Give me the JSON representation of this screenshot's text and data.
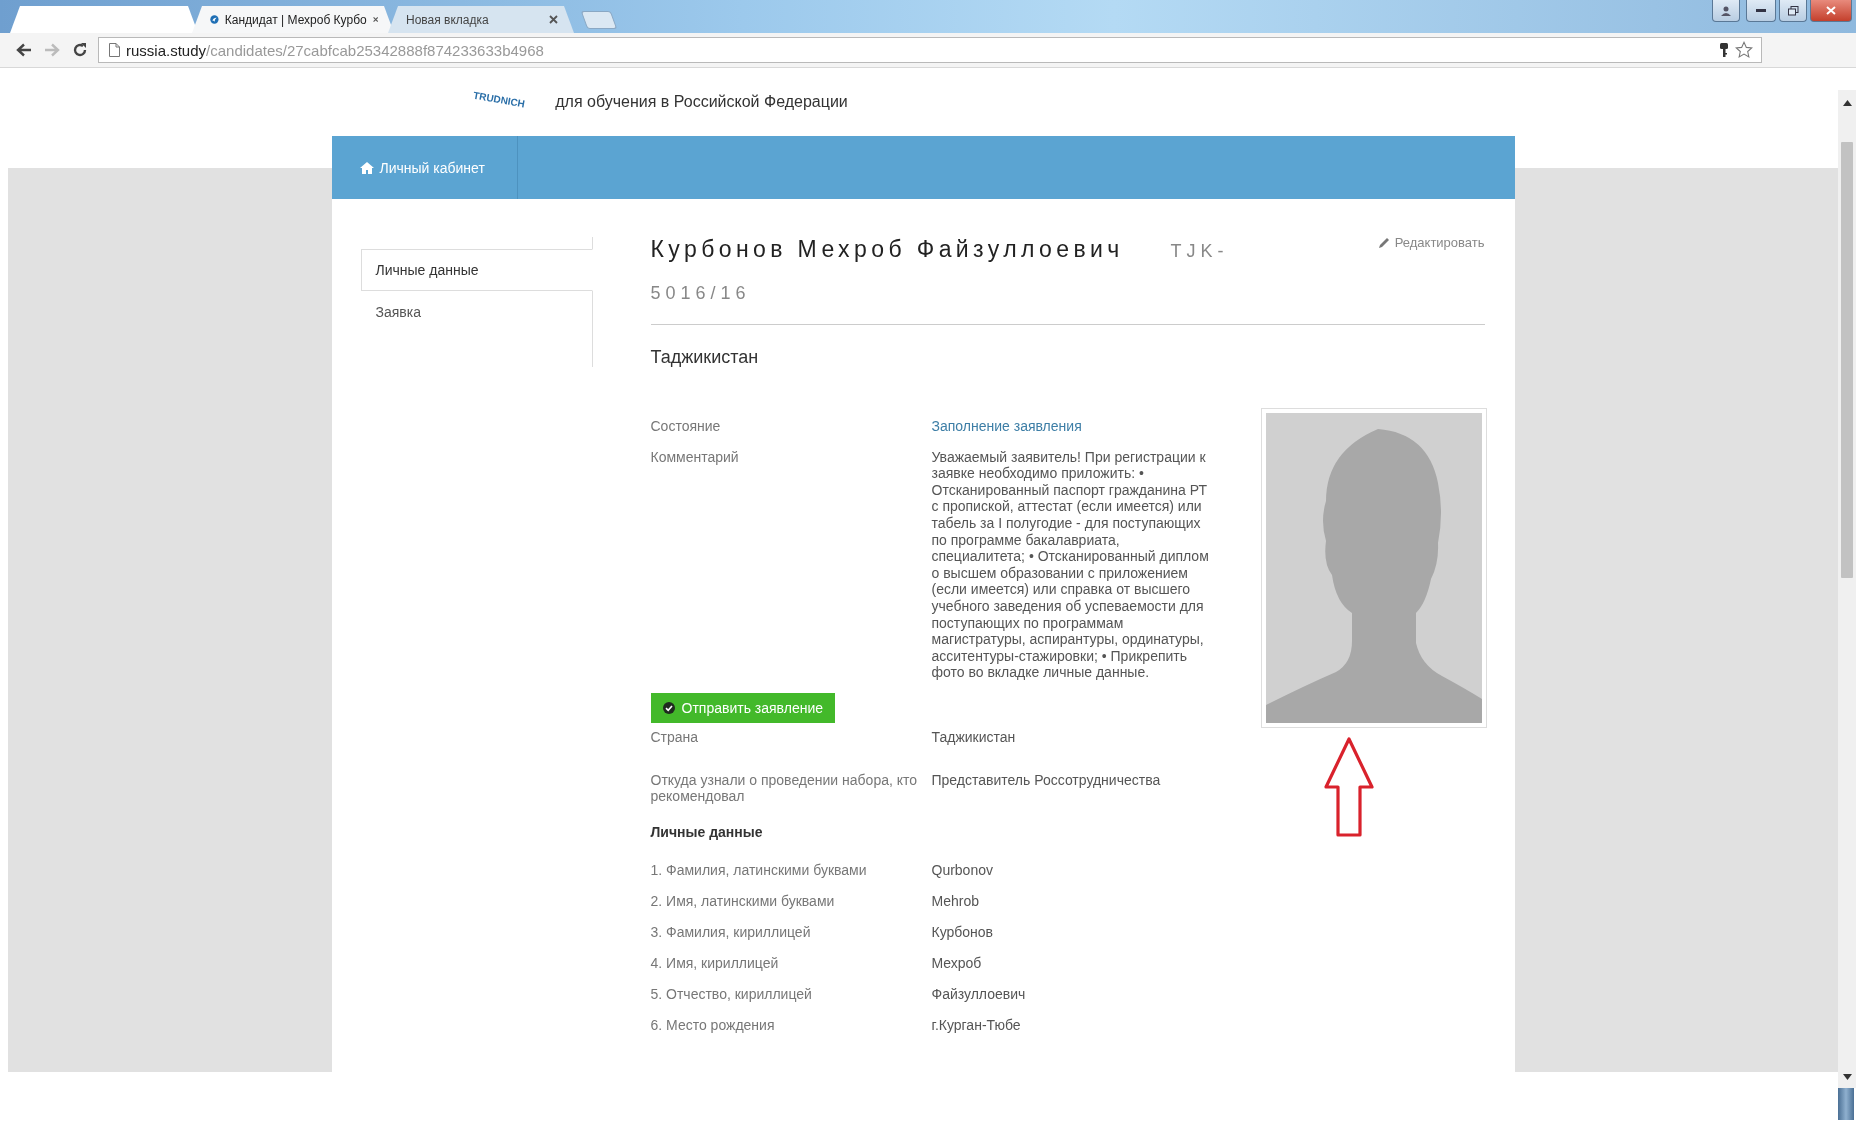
{
  "browser": {
    "tabs": [
      {
        "title": "Кандидат | Мехроб Курбо",
        "kind": "page",
        "selected": true
      },
      {
        "title": "Новая вкладка",
        "kind": "blank",
        "selected": false
      }
    ],
    "toolbar": {
      "forward_disabled": true,
      "url_host": "russia.study",
      "url_path": "/candidates/27cabfcab25342888f874233633b4968"
    }
  },
  "site_header": {
    "logo_text": "TRUDNICH",
    "subtitle": "для обучения в Российской Федерации"
  },
  "nav": {
    "items": [
      {
        "label": "Личный кабинет"
      }
    ]
  },
  "sidebar": {
    "items": [
      {
        "label": "Личные данные",
        "selected": true
      },
      {
        "label": "Заявка",
        "selected": false
      }
    ]
  },
  "profile": {
    "name": "Курбонов Мехроб Файзуллоевич",
    "code": "TJK-5016/16",
    "edit_link": "Редактировать",
    "country_heading": "Таджикистан",
    "status_rows": [
      {
        "label": "Состояние",
        "value": "Заполнение заявления",
        "kind": "link"
      },
      {
        "label": "Комментарий",
        "value": "Уважаемый заявитель! При регистрации к заявке необходимо приложить: • Отсканированный паспорт гражданина РТ с пропиской, аттестат (если имеется) или табель за I полугодие - для поступающих по программе бакалавриата, специалитета; • Отсканированный диплом о высшем образовании с приложением (если имеется) или справка от высшего учебного заведения об успеваемости для поступающих по программам магистратуры, аспирантуры, ординатуры, асситентуры-стажировки; • Прикрепить фото во вкладке личные данные.",
        "kind": "text"
      }
    ],
    "submit_button": "Отправить заявление",
    "info_rows": [
      {
        "label": "Страна",
        "value": "Таджикистан"
      },
      {
        "label": "Откуда узнали о проведении набора, кто рекомендовал",
        "value": "Представитель Россотрудничества"
      }
    ],
    "section_title": "Личные данные",
    "personal_rows": [
      {
        "label": "1. Фамилия, латинскими буквами",
        "value": "Qurbonov"
      },
      {
        "label": "2. Имя, латинскими буквами",
        "value": "Mehrob"
      },
      {
        "label": "3. Фамилия, кириллицей",
        "value": "Курбонов"
      },
      {
        "label": "4. Имя, кириллицей",
        "value": "Мехроб"
      },
      {
        "label": "5. Отчество, кириллицей",
        "value": "Файзуллоевич"
      },
      {
        "label": "6. Место рождения",
        "value": "г.Курган-Тюбе"
      }
    ]
  }
}
